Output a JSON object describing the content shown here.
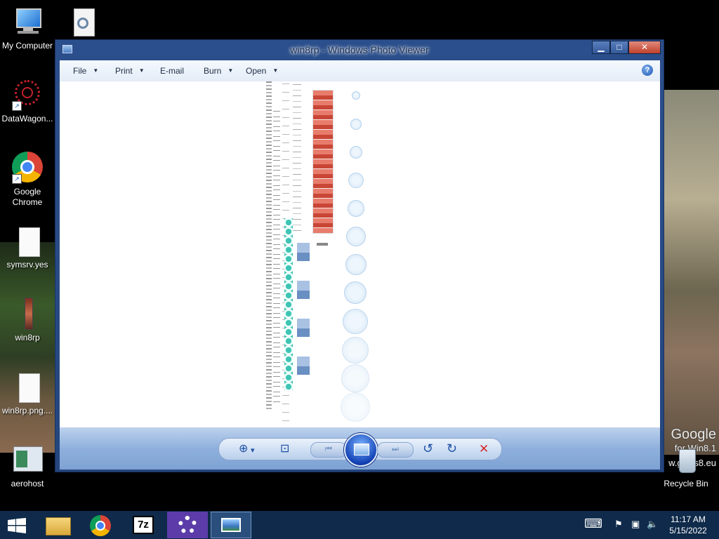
{
  "desktop": {
    "icons": [
      {
        "label": "My Computer"
      },
      {
        "label": ""
      },
      {
        "label": "DataWagon..."
      },
      {
        "label": "Google Chrome"
      },
      {
        "label": "symsrv.yes"
      },
      {
        "label": "win8rp"
      },
      {
        "label": "win8rp.png...."
      },
      {
        "label": "aerohost"
      },
      {
        "label": "Recycle Bin"
      }
    ],
    "wallpaper_text": {
      "line1": "Google",
      "line2": "for Win8.1",
      "line3": "w.glass8.eu"
    }
  },
  "window": {
    "title": "win8rp - Windows Photo Viewer",
    "min_label": "▁",
    "max_label": "□",
    "close_label": "✕",
    "menu": {
      "file": "File",
      "print": "Print",
      "email": "E-mail",
      "burn": "Burn",
      "open": "Open",
      "caret": "▼",
      "help": "?"
    },
    "controls": {
      "zoom": "⊕",
      "zoom_caret": "▾",
      "actual_size": "⊡",
      "prev": "⏮",
      "next": "⏭",
      "rotate_ccw": "↺",
      "rotate_cw": "↻",
      "delete": "✕"
    }
  },
  "taskbar": {
    "start_icon": "windows-logo",
    "apps": [
      {
        "name": "file-explorer"
      },
      {
        "name": "google-chrome"
      },
      {
        "name": "7-zip",
        "label": "7z"
      },
      {
        "name": "settings"
      },
      {
        "name": "windows-photo-viewer"
      }
    ],
    "tray": {
      "keyboard": "⌨",
      "flag": "⚑",
      "network": "▣",
      "volume": "🔈"
    },
    "time": "11:17 AM",
    "date": "5/15/2022"
  },
  "colors": {
    "taskbar": "#0f2a4a",
    "window_frame": "#2b4f8c",
    "close_button": "#c0412c",
    "accent_blue": "#1d4fa3"
  }
}
